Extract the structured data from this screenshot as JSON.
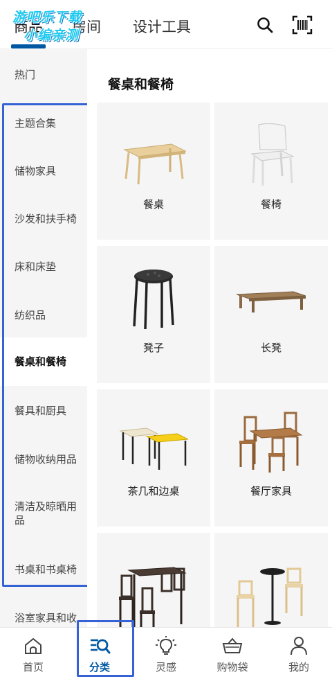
{
  "header": {
    "tabs": [
      {
        "label": "商品",
        "active": true
      },
      {
        "label": "房间",
        "active": false
      },
      {
        "label": "设计工具",
        "active": false
      }
    ],
    "watermark_line1": "游吧乐下载",
    "watermark_line2": "小编亲测",
    "icons": [
      "search-icon",
      "barcode-scan-icon"
    ]
  },
  "sidebar": {
    "items": [
      {
        "label": "热门"
      },
      {
        "label": "主题合集"
      },
      {
        "label": "储物家具"
      },
      {
        "label": "沙发和扶手椅"
      },
      {
        "label": "床和床垫"
      },
      {
        "label": "纺织品"
      },
      {
        "label": "餐桌和餐椅",
        "active": true
      },
      {
        "label": "餐具和厨具"
      },
      {
        "label": "储物收纳用品"
      },
      {
        "label": "清洁及晾晒用品"
      },
      {
        "label": "书桌和书桌椅"
      },
      {
        "label": "浴室家具和收"
      }
    ]
  },
  "main": {
    "section_title": "餐桌和餐椅",
    "cards": [
      {
        "label": "餐桌",
        "icon": "dining-table-image"
      },
      {
        "label": "餐椅",
        "icon": "dining-chair-image"
      },
      {
        "label": "凳子",
        "icon": "stool-image"
      },
      {
        "label": "长凳",
        "icon": "bench-image"
      },
      {
        "label": "茶几和边桌",
        "icon": "side-tables-image"
      },
      {
        "label": "餐厅家具",
        "icon": "dining-set-image"
      },
      {
        "label": "",
        "icon": "bar-table-set-image"
      },
      {
        "label": "",
        "icon": "cafe-set-image"
      }
    ]
  },
  "bottom_nav": {
    "items": [
      {
        "label": "首页",
        "icon": "home-icon"
      },
      {
        "label": "分类",
        "icon": "category-search-icon",
        "active": true
      },
      {
        "label": "灵感",
        "icon": "lightbulb-icon"
      },
      {
        "label": "购物袋",
        "icon": "basket-icon"
      },
      {
        "label": "我的",
        "icon": "user-icon"
      }
    ]
  },
  "colors": {
    "accent": "#0058a3",
    "highlight_box": "#3562d4",
    "sidebar_bg": "#f5f5f5",
    "watermark": "#1ec8f0"
  }
}
